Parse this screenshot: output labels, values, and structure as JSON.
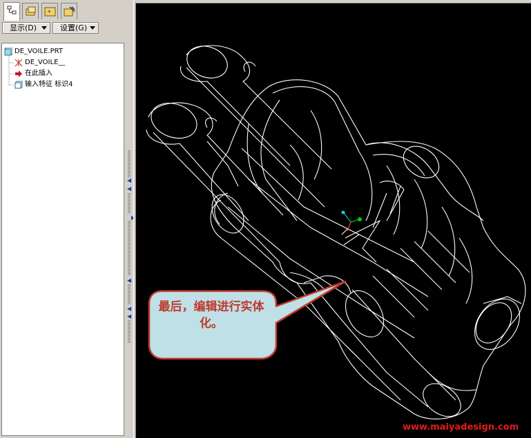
{
  "panel": {
    "show_menu_label": "显示(D)",
    "settings_menu_label": "设置(G)"
  },
  "tree": {
    "items": [
      {
        "label": "DE_VOILE.PRT",
        "icon": "part-icon"
      },
      {
        "label": "DE_VOILE__",
        "icon": "coordinate-system-icon"
      },
      {
        "label": "在此插入",
        "icon": "insert-here-arrow-icon"
      },
      {
        "label": "输入特征 标识4",
        "icon": "import-feature-icon"
      }
    ]
  },
  "callout": {
    "text": "最后，编辑进行实体化。",
    "fill": "#bfe0e6",
    "stroke": "#c0392b"
  },
  "watermark": "www.maiyadesign.com",
  "colors": {
    "viewport_bg": "#000000",
    "wireframe": "#ffffff",
    "ui_bg": "#d4d0c8"
  }
}
